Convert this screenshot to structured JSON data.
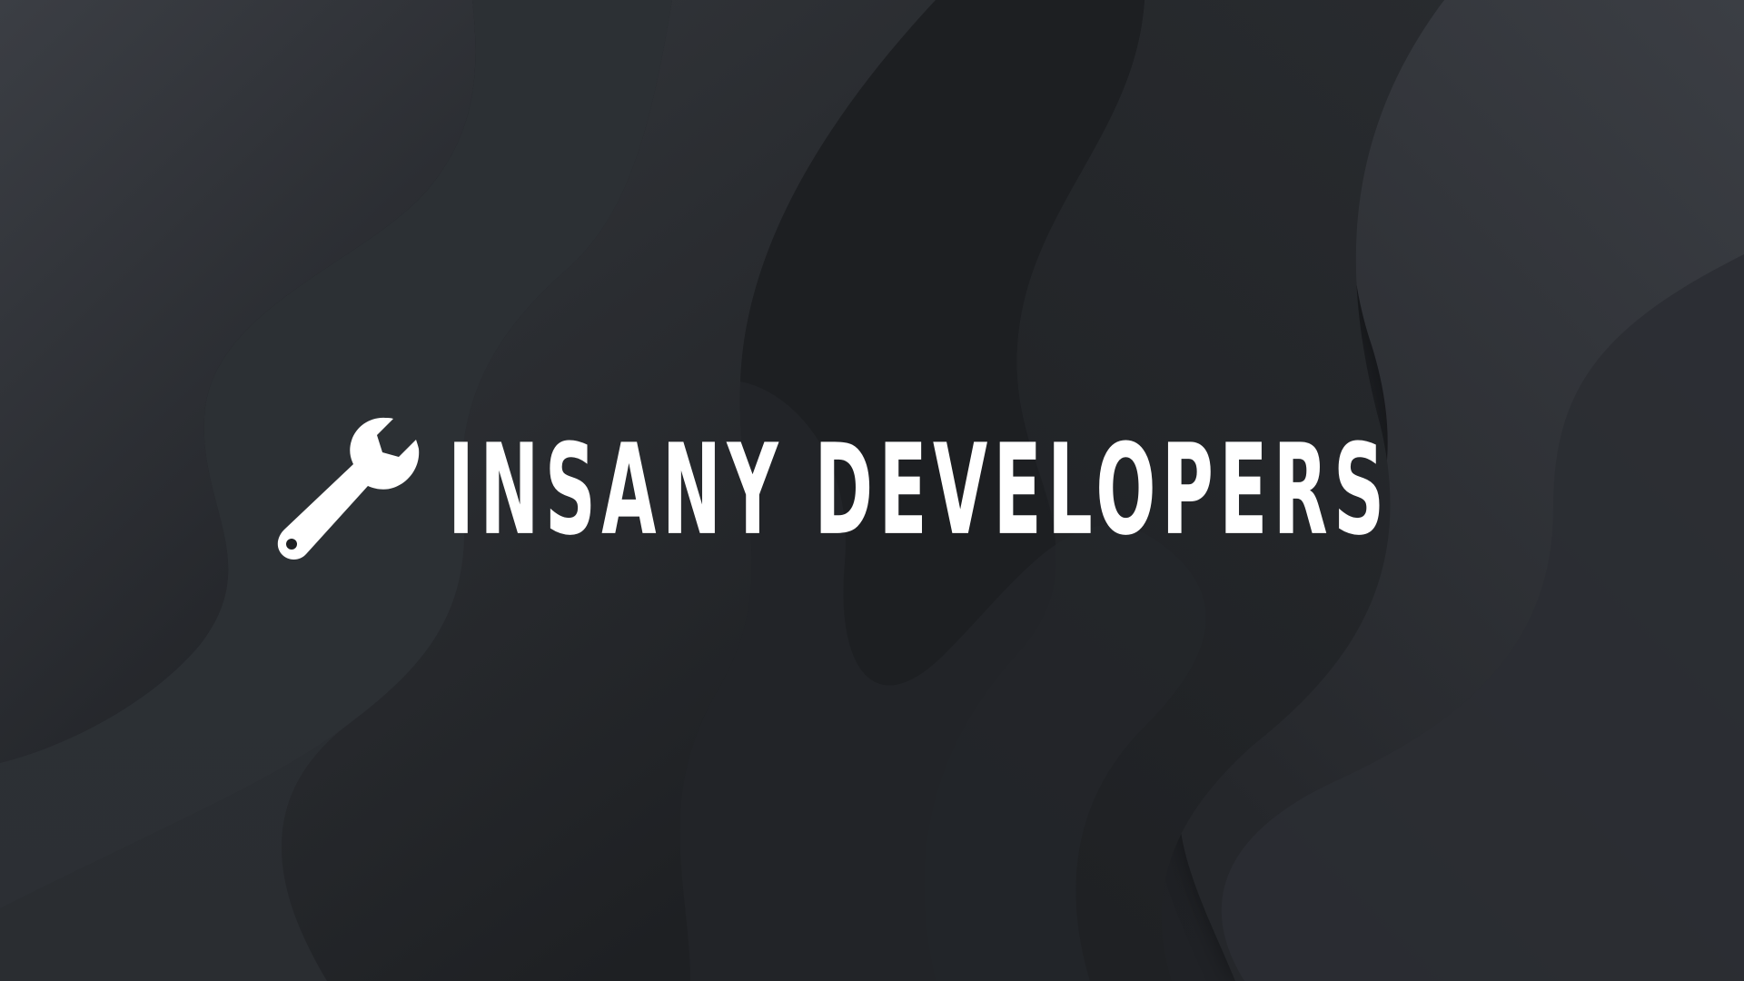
{
  "brand": {
    "title": "INSANY DEVELOPERS",
    "icon": "wrench-icon"
  },
  "colors": {
    "background_dark": "#1b1d20",
    "background_light": "#3a3d42",
    "text": "#ffffff"
  }
}
